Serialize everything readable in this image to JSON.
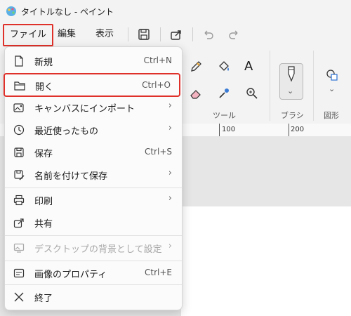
{
  "window": {
    "title": "タイトルなし - ペイント"
  },
  "menubar": {
    "file": "ファイル",
    "edit": "編集",
    "view": "表示"
  },
  "ribbon": {
    "tools_label": "ツール",
    "brush_label": "ブラシ",
    "shapes_label": "図形"
  },
  "ruler": {
    "marks": [
      "100",
      "200"
    ]
  },
  "file_menu": {
    "items": [
      {
        "label": "新規",
        "shortcut": "Ctrl+N",
        "icon": "new-file-icon"
      },
      {
        "label": "開く",
        "shortcut": "Ctrl+O",
        "icon": "folder-icon"
      },
      {
        "label": "キャンバスにインポート",
        "shortcut": "",
        "icon": "import-image-icon"
      },
      {
        "label": "最近使ったもの",
        "shortcut": "",
        "icon": "clock-icon"
      },
      {
        "label": "保存",
        "shortcut": "Ctrl+S",
        "icon": "save-icon"
      },
      {
        "label": "名前を付けて保存",
        "shortcut": "",
        "icon": "save-as-icon"
      },
      {
        "label": "印刷",
        "shortcut": "",
        "icon": "printer-icon"
      },
      {
        "label": "共有",
        "shortcut": "",
        "icon": "share-icon"
      },
      {
        "label": "デスクトップの背景として設定",
        "shortcut": "",
        "icon": "wallpaper-icon"
      },
      {
        "label": "画像のプロパティ",
        "shortcut": "Ctrl+E",
        "icon": "properties-icon"
      },
      {
        "label": "終了",
        "shortcut": "",
        "icon": "close-icon"
      }
    ],
    "submenu_arrow": "›"
  }
}
